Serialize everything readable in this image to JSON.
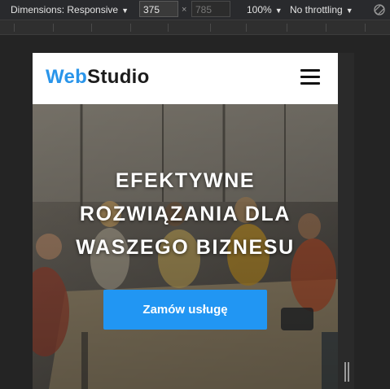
{
  "devtools": {
    "dimensions_label": "Dimensions: Responsive",
    "width_value": "375",
    "height_placeholder": "785",
    "times_symbol": "×",
    "zoom": "100%",
    "throttling": "No throttling",
    "caret": "▼"
  },
  "site": {
    "logo_web": "Web",
    "logo_studio": "Studio",
    "hero_title_lines": [
      "EFEKTYWNE",
      "ROZWIĄZANIA DLA",
      "WASZEGO BIZNESU"
    ],
    "cta_label": "Zamów usługę"
  },
  "colors": {
    "accent": "#2196f3",
    "logo_blue": "#2a95ea",
    "devtools_bg": "#292a2d"
  }
}
